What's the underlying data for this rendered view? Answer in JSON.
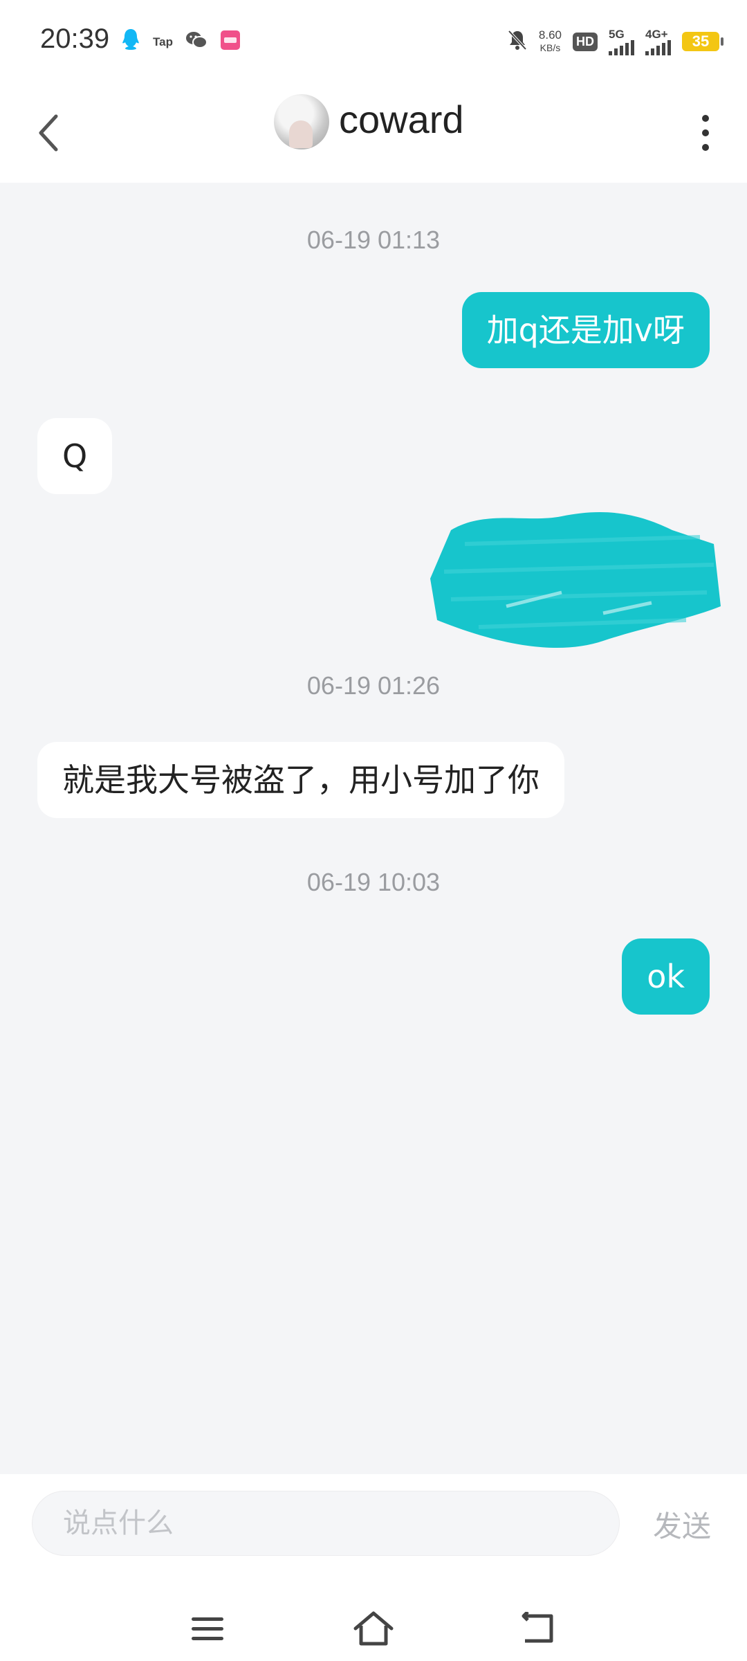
{
  "status_bar": {
    "time": "20:39",
    "left_icons": [
      "qq-icon",
      "tap-icon",
      "wechat-icon",
      "lofter-icon"
    ],
    "tap_label": "Tap",
    "net_speed_value": "8.60",
    "net_speed_unit": "KB/s",
    "hd_label": "HD",
    "sim1_label": "5G",
    "sim2_label": "4G+",
    "battery": "35"
  },
  "header": {
    "back_icon": "chevron-left-icon",
    "contact_name": "coward",
    "more_icon": "vertical-dots-icon"
  },
  "messages": {
    "ts1": "06-19 01:13",
    "msg1": "加q还是加v呀",
    "msg2": "Q",
    "ts2": "06-19 01:26",
    "msg3": "就是我大号被盗了，用小号加了你",
    "ts3": "06-19 10:03",
    "msg4": "ok"
  },
  "input": {
    "placeholder": "说点什么",
    "send_label": "发送"
  },
  "nav_bar": {
    "menu_icon": "menu-icon",
    "home_icon": "home-icon",
    "back_icon": "back-icon"
  },
  "colors": {
    "accent": "#17c5cc",
    "background": "#f4f5f7",
    "incoming_bubble": "#ffffff"
  }
}
